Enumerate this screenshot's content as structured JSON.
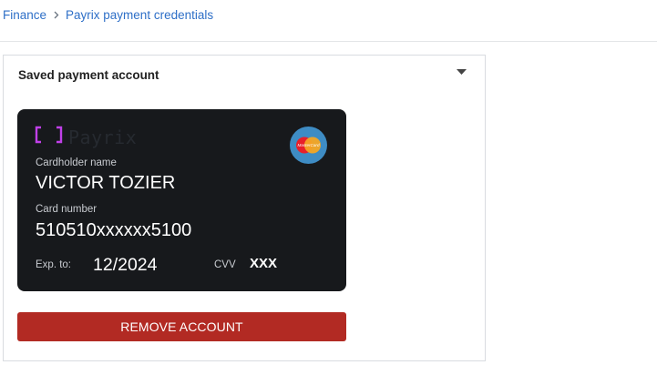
{
  "breadcrumb": {
    "parent": "Finance",
    "current": "Payrix payment credentials"
  },
  "panel": {
    "title": "Saved payment account",
    "toggle_icon": "caret-down-icon"
  },
  "card": {
    "brand_icon": "payrix-bracket-logo-icon",
    "brand_name": "Payrix",
    "network_icon": "mastercard-logo-icon",
    "network_logo_text": "MasterCard",
    "cardholder_label": "Cardholder name",
    "cardholder_value": "VICTOR TOZIER",
    "number_label": "Card number",
    "number_value": "510510xxxxxx5100",
    "exp_label": "Exp. to:",
    "exp_value": "12/2024",
    "cvv_label": "CVV",
    "cvv_value": "XXX"
  },
  "actions": {
    "remove_label": "REMOVE ACCOUNT"
  },
  "colors": {
    "link": "#2e6fc7",
    "card_bg": "#17191c",
    "bracket_accent": "#c040e8",
    "danger": "#b22a23",
    "badge_bg": "#3e8cc4"
  }
}
